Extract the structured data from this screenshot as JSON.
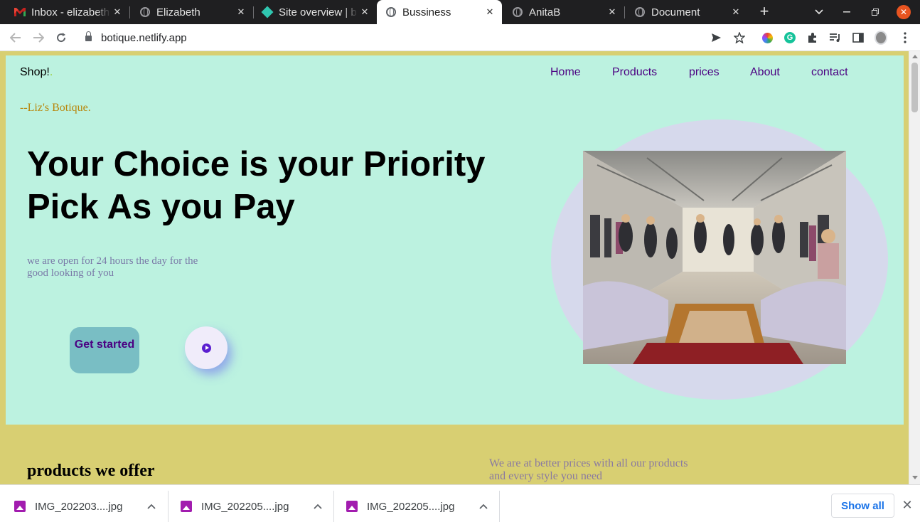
{
  "browser": {
    "tabs": [
      {
        "title": "Inbox - elizabeth",
        "icon": "gmail-icon",
        "active": false
      },
      {
        "title": "Elizabeth",
        "icon": "globe-icon",
        "active": false
      },
      {
        "title": "Site overview | b",
        "icon": "netlify-icon",
        "active": false
      },
      {
        "title": "Bussiness",
        "icon": "globe-icon",
        "active": true
      },
      {
        "title": "AnitaB",
        "icon": "globe-icon",
        "active": false
      },
      {
        "title": "Document",
        "icon": "globe-icon",
        "active": false
      }
    ],
    "close_glyph": "✕",
    "new_tab_glyph": "+",
    "address": "botique.netlify.app"
  },
  "site": {
    "logo": "Shop!",
    "logo_dot": ".",
    "nav": [
      "Home",
      "Products",
      "prices",
      "About",
      "contact"
    ],
    "tagline": "--Liz's Botique.",
    "headline_line1": "Your Choice is your Priority",
    "headline_line2": "Pick As you Pay",
    "subtext": "we are open for 24 hours the day for the good looking of you",
    "cta_label": "Get started",
    "section_title": "products we offer",
    "section_text": "We are at better prices with all our products and every style you need"
  },
  "downloads": {
    "files": [
      "IMG_202203....jpg",
      "IMG_202205....jpg",
      "IMG_202205....jpg"
    ],
    "show_all_label": "Show all"
  },
  "colors": {
    "page_bg": "#d8cf72",
    "hero_bg": "#bcf2e0",
    "nav_text": "#4b0082",
    "cta_bg": "#79bec4",
    "blob": "#d6d9ec",
    "tab_strip": "#1f1f21"
  }
}
